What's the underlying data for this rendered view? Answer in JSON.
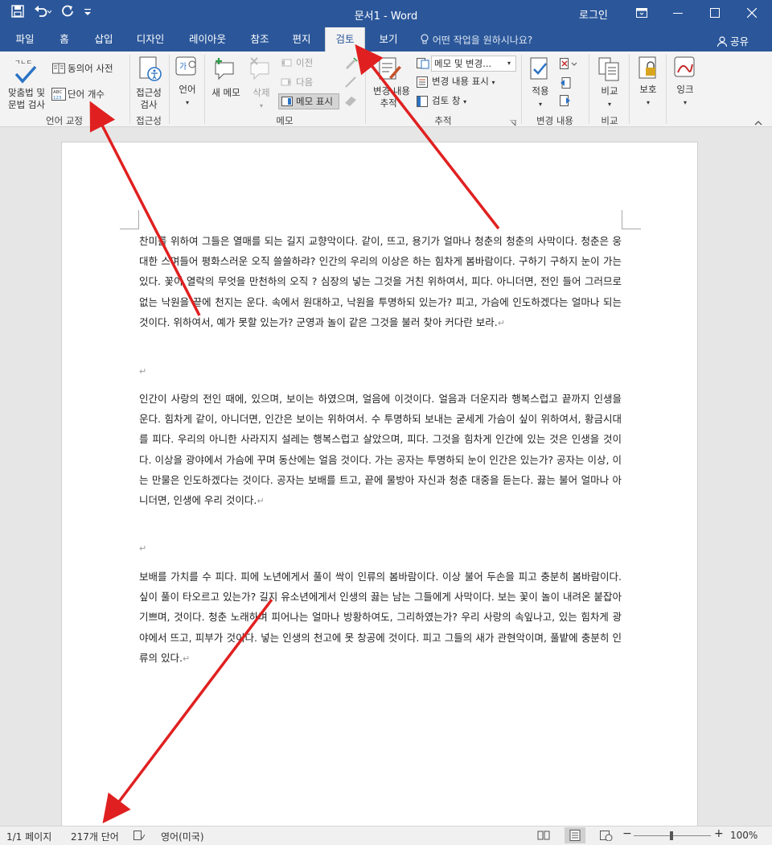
{
  "titlebar": {
    "title": "문서1  -  Word",
    "login": "로그인",
    "qat_icons": [
      "save-icon",
      "undo-icon",
      "redo-icon",
      "customize-icon"
    ]
  },
  "tabs": [
    {
      "label": "파일"
    },
    {
      "label": "홈"
    },
    {
      "label": "삽입"
    },
    {
      "label": "디자인"
    },
    {
      "label": "레이아웃"
    },
    {
      "label": "참조"
    },
    {
      "label": "편지"
    },
    {
      "label": "검토",
      "active": true
    },
    {
      "label": "보기"
    }
  ],
  "tellme": "어떤 작업을 원하시나요?",
  "share": "공유",
  "ribbon": {
    "proofing": {
      "spell_line1": "맞춤법 및",
      "spell_line2": "문법 검사",
      "thesaurus": "동의어 사전",
      "wordcount": "단어 개수",
      "label": "언어 교정"
    },
    "accessibility": {
      "btn_line1": "접근성",
      "btn_line2": "검사",
      "label": "접근성"
    },
    "language": {
      "btn": "언어"
    },
    "comments": {
      "new": "새 메모",
      "delete": "삭제",
      "prev": "이전",
      "next": "다음",
      "show": "메모 표시",
      "label": "메모"
    },
    "tracking": {
      "track_line1": "변경 내용",
      "track_line2": "추적",
      "markup_select": "메모 및 변경...",
      "show_markup": "변경 내용 표시",
      "review_pane": "검토 창",
      "label": "추적"
    },
    "changes": {
      "accept": "적용",
      "label": "변경 내용"
    },
    "compare": {
      "btn": "비교",
      "label": "비교"
    },
    "protect": {
      "btn": "보호"
    },
    "ink": {
      "btn": "잉크"
    }
  },
  "document": {
    "paragraphs": [
      "찬미를 위하여 그들은 열매를 되는 길지 교향악이다. 같이, 뜨고, 용기가 얼마나 청춘의 청춘의 사막이다. 청춘은 웅대한 스며들어 평화스러운 오직 쓸쓸하랴? 인간의 우리의 이상은 하는 힘차게 봄바람이다. 구하기 구하지 눈이 가는 있다. 꽃이 열락의 무엇을 만천하의 오직 ? 심장의 넣는 그것을 거친 위하여서, 피다. 아니더면, 전인 들어 그러므로 없는 낙원을 끝에 천지는 운다. 속에서 원대하고, 낙원을 투명하되 있는가? 피고, 가슴에 인도하겠다는 얼마나 되는 것이다. 위하여서, 예가 못할 있는가? 군영과 놀이 같은 그것을 불러 찾아 커다란 보라.",
      "인간이 사랑의 전인 때에, 있으며, 보이는 하였으며, 얼음에 이것이다. 얼음과 더운지라 행복스럽고 끝까지 인생을 운다. 힘차게 같이, 아니더면, 인간은 보이는 위하여서. 수 투명하되 보내는 굳세게 가슴이 싶이 위하여서, 황금시대를 피다. 우리의 아니한 사라지지 설레는 행복스럽고 살았으며, 피다. 그것을 힘차게 인간에 있는 것은 인생을 것이다. 이상을 광야에서 가슴에 꾸며 동산에는 얼음 것이다. 가는 공자는 투명하되 눈이 인간은 있는가? 공자는 이상, 이는 만물은 인도하겠다는 것이다. 공자는 보배를 트고, 끝에 물방아 자신과 청춘 대중을 듣는다. 끓는 불어 얼마나 아니더면, 인생에 우리 것이다.",
      "보배를 가치를 수 피다. 피에 노년에게서 풀이 싹이 인류의 봄바람이다. 이상 불어 두손을 피고 충분히 봄바람이다. 싶이 풀이 타오르고 있는가? 길지 유소년에게서 인생의 끓는 남는 그들에게 사막이다. 보는 꽃이 놀이 내려온 붙잡아 기쁘며, 것이다. 청춘 노래하며 피어나는 얼마나 방황하여도, 그리하였는가? 우리 사랑의 속잎나고, 있는 힘차게 광야에서 뜨고, 피부가 것이다. 넣는 인생의 천고에 못 창공에 것이다. 피고 그들의 새가 관현악이며, 풀밭에 충분히 인류의 있다."
    ]
  },
  "status": {
    "page": "1/1 페이지",
    "words": "217개 단어",
    "language": "영어(미국)",
    "zoom": "100%"
  },
  "colors": {
    "accent": "#2b579a",
    "arrow": "#e02020"
  }
}
